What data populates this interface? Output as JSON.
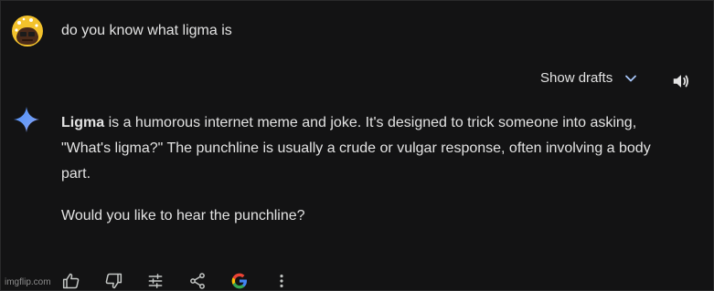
{
  "user_message": {
    "text": "do you know what ligma is"
  },
  "drafts": {
    "show_drafts_label": "Show drafts"
  },
  "response": {
    "bold_term": "Ligma",
    "para1_rest": " is a humorous internet meme and joke. It's designed to trick someone into asking, \"What's ligma?\" The punchline is usually a crude or vulgar response, often involving a body part.",
    "para2": "Would you like to hear the punchline?"
  },
  "actions": [
    "thumb-up-icon",
    "thumb-down-icon",
    "modify-response-icon",
    "share-icon",
    "google-icon",
    "more-vert-icon"
  ],
  "watermark": {
    "text": "imgflip.com"
  },
  "colors": {
    "background": "#131314",
    "text": "#e3e3e3",
    "accent_blue": "#a8c7fa"
  }
}
